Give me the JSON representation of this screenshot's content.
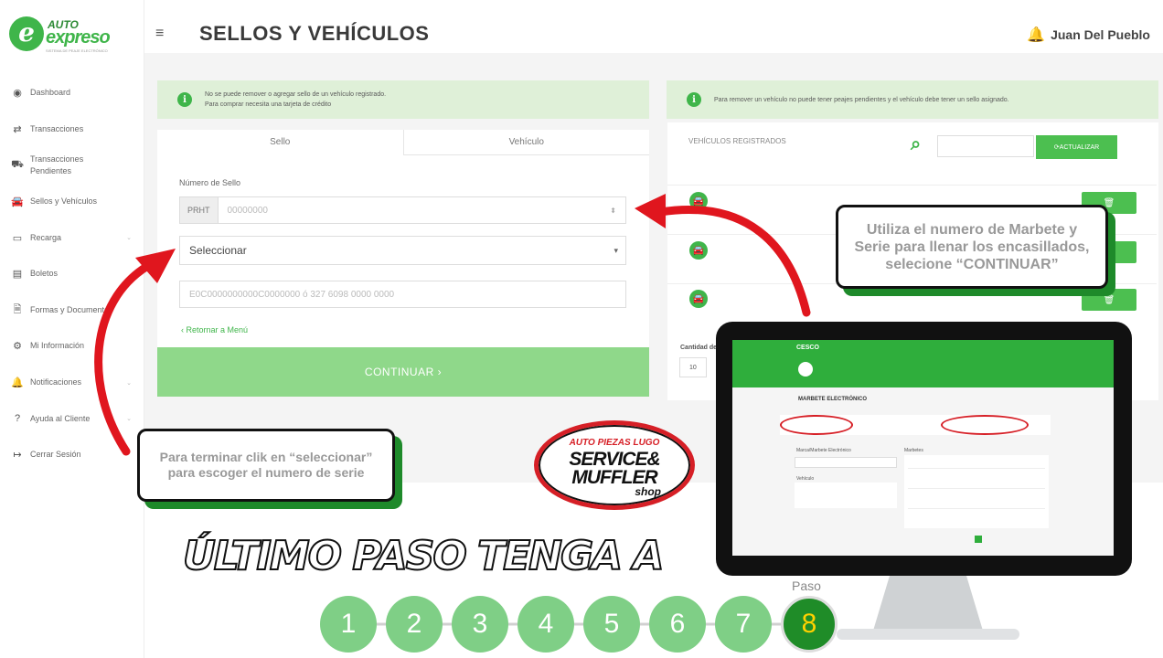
{
  "brand": {
    "logo_letter": "e",
    "auto": "AUTO",
    "name": "expreso",
    "tagline": "SISTEMA DE PEAJE ELECTRÓNICO"
  },
  "sidebar": {
    "items": [
      {
        "icon": "dashboard-icon",
        "glyph": "◉",
        "label": "Dashboard",
        "chevron": false
      },
      {
        "icon": "transfer-icon",
        "glyph": "⇄",
        "label": "Transacciones",
        "chevron": false
      },
      {
        "icon": "truck-icon",
        "glyph": "⛟",
        "label": "Transacciones Pendientes",
        "chevron": false
      },
      {
        "icon": "car-icon",
        "glyph": "🚘",
        "label": "Sellos y Vehículos",
        "chevron": false
      },
      {
        "icon": "card-icon",
        "glyph": "▭",
        "label": "Recarga",
        "chevron": true
      },
      {
        "icon": "receipt-icon",
        "glyph": "▤",
        "label": "Boletos",
        "chevron": false
      },
      {
        "icon": "document-icon",
        "glyph": "🗎",
        "label": "Formas y Documentos",
        "chevron": false
      },
      {
        "icon": "gear-icon",
        "glyph": "⚙",
        "label": "Mi Información",
        "chevron": false
      },
      {
        "icon": "bell-icon",
        "glyph": "🔔",
        "label": "Notificaciones",
        "chevron": true
      },
      {
        "icon": "help-icon",
        "glyph": "?",
        "label": "Ayuda al Cliente",
        "chevron": true
      },
      {
        "icon": "logout-icon",
        "glyph": "↦",
        "label": "Cerrar Sesión",
        "chevron": false
      }
    ]
  },
  "header": {
    "menu_glyph": "≡",
    "title": "SELLOS Y VEHÍCULOS",
    "user": "Juan Del Pueblo"
  },
  "alerts": {
    "left_line1": "No se puede remover o agregar sello de un vehículo registrado.",
    "left_line2": "Para comprar necesita una tarjeta de crédito",
    "right": "Para remover un vehículo no puede tener peajes pendientes y el vehículo debe tener un sello asignado."
  },
  "form": {
    "tab_sello": "Sello",
    "tab_vehiculo": "Vehículo",
    "numero_label": "Número de Sello",
    "prefix": "PRHT",
    "numero_placeholder": "00000000",
    "select_value": "Seleccionar",
    "serie_placeholder": "E0C0000000000C0000000 ó 327 6098 0000 0000",
    "back_link": "Retornar a Menú",
    "continue": "CONTINUAR"
  },
  "vehicles": {
    "title": "VEHÍCULOS REGISTRADOS",
    "update_button": "ACTUALIZAR",
    "qty_label": "Cantidad de",
    "qty_value": "10"
  },
  "callouts": {
    "right_line1": "Utiliza el numero de Marbete y",
    "right_line2": "Serie para llenar los encasillados,",
    "right_line3": "selecione “CONTINUAR”",
    "left_line1": "Para terminar clik en “seleccionar”",
    "left_line2": "para escoger el numero de serie"
  },
  "badge": {
    "line1": "AUTO PIEZAS LUGO",
    "line2": "SERVICE&",
    "line3": "MUFFLER",
    "line4": "shop"
  },
  "monitor": {
    "logo": "CESCO",
    "section": "MARBETE ELECTRÓNICO",
    "col_left": "Marca/Marbete Electrónico",
    "col_right": "Marbetes",
    "vehicle_label": "Vehículo"
  },
  "caption": "ÚLTIMO PASO TENGA A",
  "paso_label": "Paso",
  "steps": [
    "1",
    "2",
    "3",
    "4",
    "5",
    "6",
    "7",
    "8"
  ],
  "current_step": "8",
  "colors": {
    "brand_green": "#3fb54a",
    "alert_bg": "#dff0d8",
    "button_light": "#8fd88a",
    "arrow_red": "#e0161e"
  }
}
